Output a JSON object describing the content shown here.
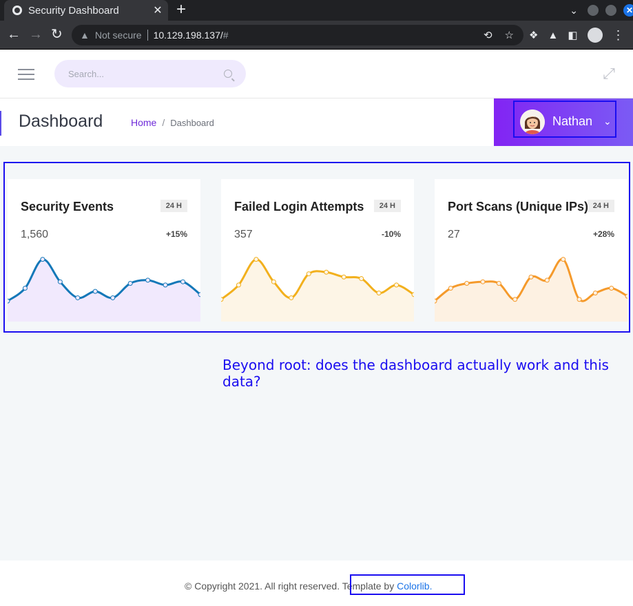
{
  "browser": {
    "tab_title": "Security Dashboard",
    "tab_close": "✕",
    "new_tab": "+",
    "address_warning": "Not secure",
    "url": "10.129.198.137/",
    "url_hash": "#"
  },
  "topbar": {
    "search_placeholder": "Search..."
  },
  "header": {
    "page_title": "Dashboard",
    "breadcrumb": {
      "home": "Home",
      "separator": "/",
      "current": "Dashboard"
    },
    "user": {
      "name": "Nathan"
    }
  },
  "cards": [
    {
      "title": "Security Events",
      "badge": "24 H",
      "value": "1,560",
      "change": "+15%",
      "color": "#1478b8",
      "fill": "#f1e9fd",
      "sparkline": [
        12,
        20,
        38,
        24,
        14,
        18,
        14,
        23,
        25,
        22,
        24,
        16
      ]
    },
    {
      "title": "Failed Login Attempts",
      "badge": "24 H",
      "value": "357",
      "change": "-10%",
      "color": "#f2b01d",
      "fill": "#fdf5e6",
      "sparkline": [
        13,
        22,
        38,
        24,
        14,
        29,
        30,
        27,
        26,
        17,
        22,
        16
      ]
    },
    {
      "title": "Port Scans (Unique IPs)",
      "badge": "24 H",
      "value": "27",
      "change": "+28%",
      "color": "#f59a2b",
      "fill": "#fdf1e2",
      "sparkline": [
        12,
        20,
        23,
        24,
        23,
        13,
        27,
        25,
        38,
        13,
        17,
        20,
        15
      ]
    }
  ],
  "annotation": "Beyond root: does the dashboard actually work and this data?",
  "footer": {
    "copyright": "© Copyright 2021. All right reserved. ",
    "template_prefix": "Template by ",
    "template_link": "Colorlib",
    "period": "."
  }
}
